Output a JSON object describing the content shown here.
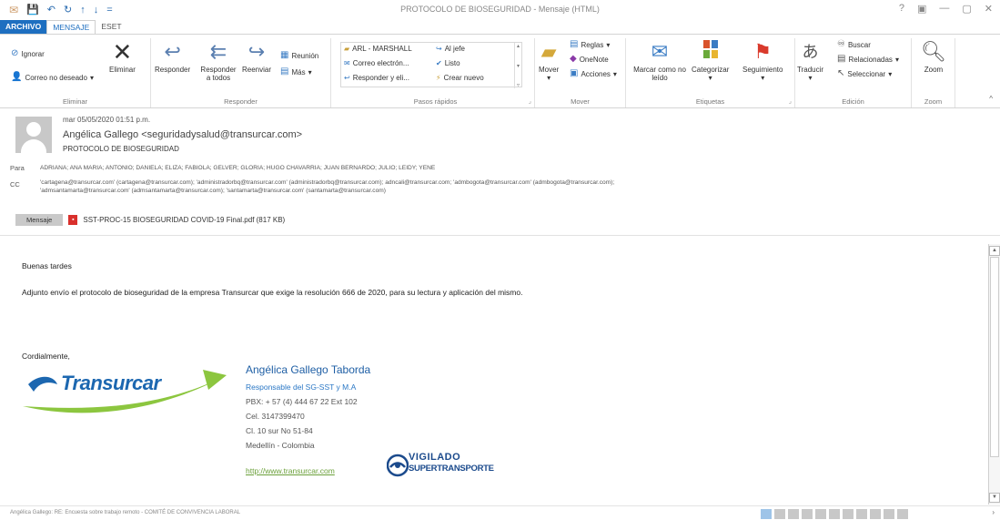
{
  "window": {
    "title": "PROTOCOLO DE BIOSEGURIDAD - Mensaje (HTML)",
    "controls": [
      "?",
      "▣",
      "—",
      "▢",
      "✕"
    ]
  },
  "qat": [
    "✉",
    "💾",
    "↶",
    "↻",
    "↑",
    "↓",
    "="
  ],
  "tabs": [
    "ARCHIVO",
    "MENSAJE",
    "ESET"
  ],
  "ribbon": {
    "eliminar": {
      "label": "Eliminar",
      "ignore": "Ignorar",
      "junk": "Correo no deseado",
      "delete": "Eliminar"
    },
    "responder": {
      "label": "Responder",
      "reply": "Responder",
      "reply_all": "Responder a todos",
      "forward": "Reenviar",
      "meeting": "Reunión",
      "more": "Más"
    },
    "pasos": {
      "label": "Pasos rápidos",
      "items": [
        "ARL - MARSHALL",
        "Al jefe",
        "Correo electrón...",
        "Listo",
        "Responder y eli...",
        "Crear nuevo"
      ]
    },
    "mover": {
      "label": "Mover",
      "move": "Mover",
      "rules": "Reglas",
      "onenote": "OneNote",
      "actions": "Acciones"
    },
    "etiquetas": {
      "label": "Etiquetas",
      "unread": "Marcar como no leído",
      "categorize": "Categorizar",
      "followup": "Seguimiento"
    },
    "edicion": {
      "label": "Edición",
      "translate": "Traducir",
      "find": "Buscar",
      "related": "Relacionadas",
      "select": "Seleccionar"
    },
    "zoom": {
      "label": "Zoom",
      "zoom": "Zoom"
    },
    "collapse": "^"
  },
  "header": {
    "date": "mar 05/05/2020 01:51 p.m.",
    "sender": "Angélica Gallego <seguridadysalud@transurcar.com>",
    "subject": "PROTOCOLO DE BIOSEGURIDAD",
    "to_label": "Para",
    "to": "ADRIANA; ANA MARIA; ANTONIO; DANIELA; ELIZA; FABIOLA; GELVER; GLORIA; HUGO CHAVARRIA; JUAN BERNARDO; JULIO; LEIDY; YENE",
    "cc_label": "CC",
    "cc_line1": "'cartagena@transurcar.com' (cartagena@transurcar.com); 'administradorbq@transurcar.com' (administradorbq@transurcar.com); adncali@transurcar.com; 'admbogota@transurcar.com' (admbogota@transurcar.com);",
    "cc_line2": "'admsantamarta@transurcar.com' (admsantamarta@transurcar.com); 'santamarta@transurcar.com' (santamarta@transurcar.com)",
    "message_tab": "Mensaje",
    "attachment": "SST-PROC-15 BIOSEGURIDAD COVID-19 Final.pdf (817 KB)"
  },
  "body": {
    "greeting": "Buenas tardes",
    "paragraph": "Adjunto envío el protocolo de bioseguridad de la empresa Transurcar que exige la resolución 666 de 2020, para su lectura y aplicación del mismo.",
    "closing": "Cordialmente,"
  },
  "signature": {
    "logo": "Transurcar",
    "name": "Angélica Gallego Taborda",
    "role": "Responsable del SG-SST y M.A",
    "pbx": "PBX: + 57 (4) 444 67 22 Ext 102",
    "cel": "Cel. 3147399470",
    "address": "Cl. 10 sur No 51-84",
    "city": "Medellín - Colombia",
    "url": "http://www.transurcar.com",
    "vigilado_top": "VIGILADO",
    "vigilado_bottom": "SUPERTRANSPORTE"
  },
  "status": {
    "text": "Angélica Gallego: RE: Encuesta sobre trabajo remoto - COMITÉ DE CONVIVENCIA LABORAL",
    "arrow": "›"
  },
  "colors": {
    "accent": "#1e6fc0",
    "logo_blue": "#1c67b0",
    "logo_green": "#8cc63f",
    "link_green": "#6ba03a"
  }
}
